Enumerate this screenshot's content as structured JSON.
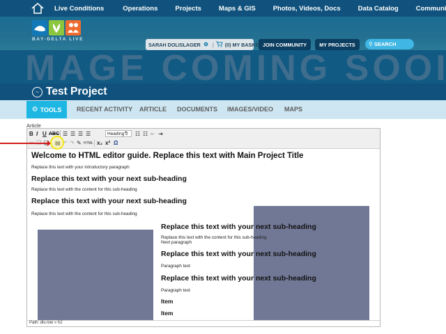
{
  "topnav": {
    "home_icon": "home-icon",
    "items": [
      "Live Conditions",
      "Operations",
      "Projects",
      "Maps & GIS",
      "Photos, Videos, Docs",
      "Data Catalog",
      "Community"
    ]
  },
  "header": {
    "logo_text": "BAY-DELTA LIVE",
    "user_name": "SARAH DOLISLAGER",
    "basket": "(0) MY BASKET",
    "join": "JOIN COMMUNITY",
    "my_projects": "MY PROJECTS",
    "search_placeholder": "SEARCH",
    "icons": [
      "back-arrow-icon",
      "refresh-icon",
      "menu-icon"
    ]
  },
  "banner": {
    "text": "MAGE COMING SOOI"
  },
  "project": {
    "title": "Test Project"
  },
  "tabs": {
    "tools": "TOOLS",
    "items": [
      "RECENT ACTIVITY",
      "ARTICLE",
      "DOCUMENTS",
      "IMAGES/VIDEO",
      "MAPS"
    ]
  },
  "editor": {
    "label": "Article",
    "format_value": "Heading 2",
    "h1": "Welcome to HTML editor guide. Replace this text with Main Project Title",
    "p_intro": "Replace this text with your introductory paragraph",
    "h2": "Replace this text with your next sub-heading",
    "p_sub": "Replace this text with the content for this sub-heading",
    "next_paragraph": "Next paragraph",
    "paragraph_text": "Paragraph text",
    "item": "Item",
    "path": "Path: div.row » h2"
  },
  "colors": {
    "nav_bg": "#10527d",
    "tab_active": "#1eb7e3",
    "tab_bar": "#cde6f1",
    "image_placeholder": "#717895",
    "annotation_arrow": "#d11a1a",
    "annotation_circle": "#f4e61b"
  }
}
